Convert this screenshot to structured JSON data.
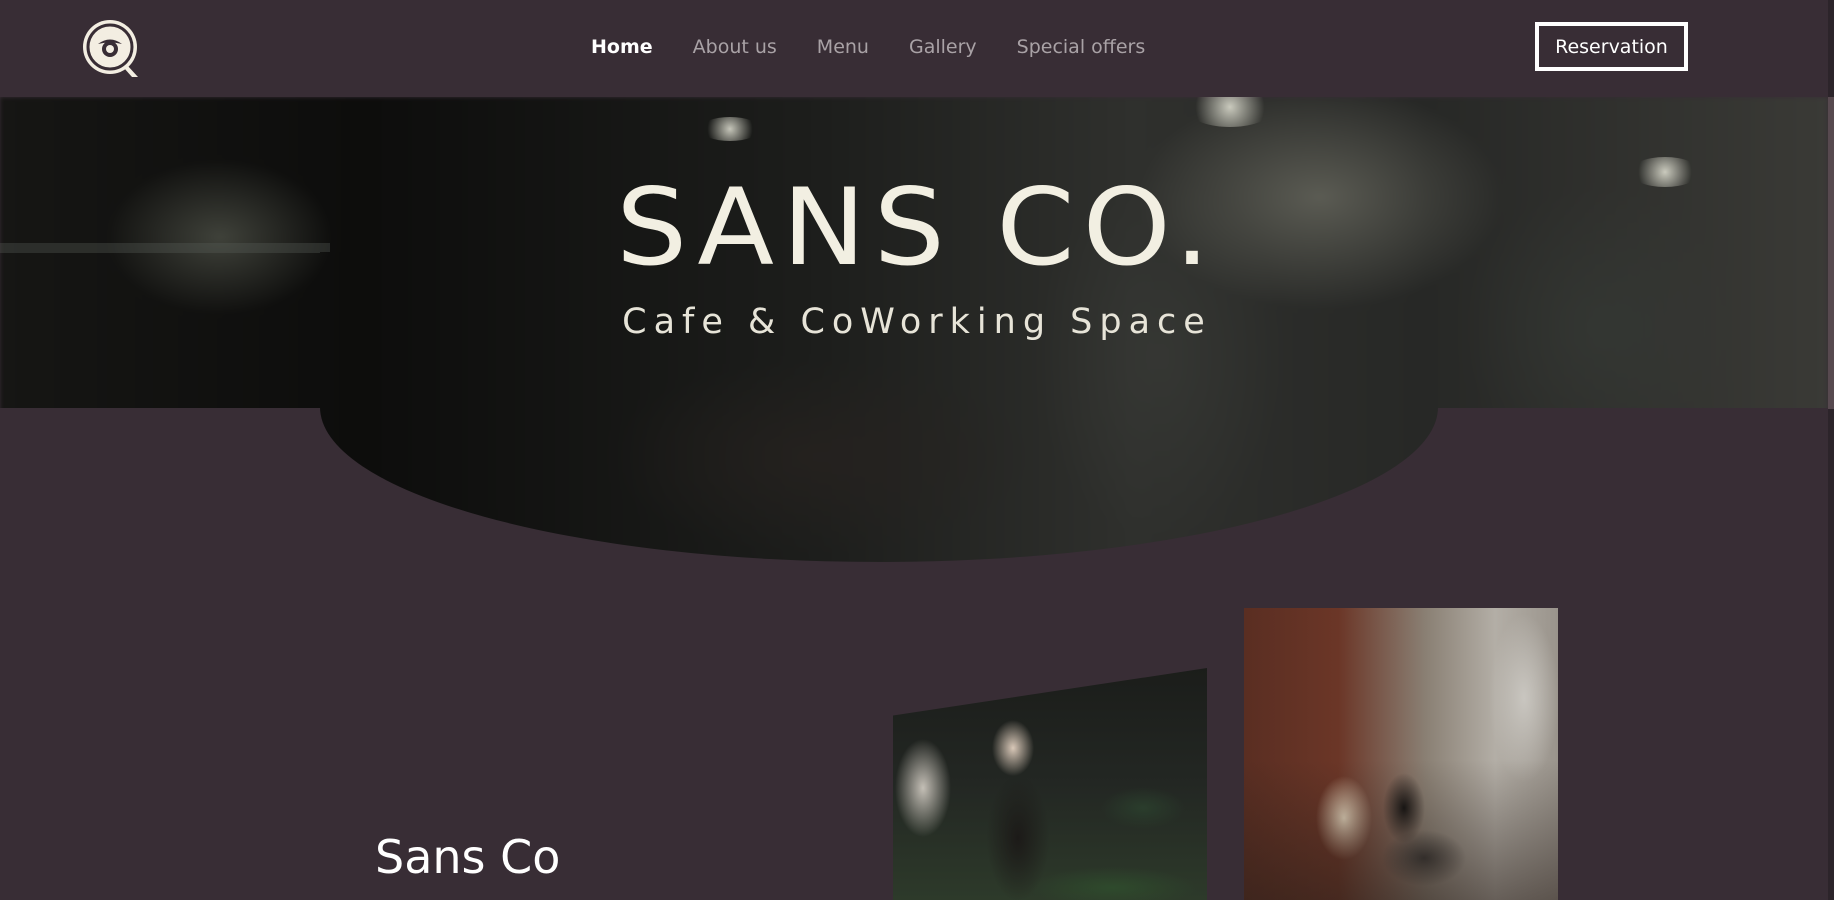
{
  "logo": {
    "icon": "coffee-cup-logo-icon"
  },
  "nav": {
    "links": [
      {
        "label": "Home",
        "active": true
      },
      {
        "label": "About us",
        "active": false
      },
      {
        "label": "Menu",
        "active": false
      },
      {
        "label": "Gallery",
        "active": false
      },
      {
        "label": "Special offers",
        "active": false
      }
    ],
    "reservation_label": "Reservation"
  },
  "hero": {
    "title": "SANS CO.",
    "subtitle": "Cafe & CoWorking Space"
  },
  "about": {
    "title": "Sans Co"
  },
  "colors": {
    "background": "#382d35",
    "nav_text": "#a9a2a6",
    "nav_active": "#ffffff",
    "hero_text": "#f2efe2"
  }
}
